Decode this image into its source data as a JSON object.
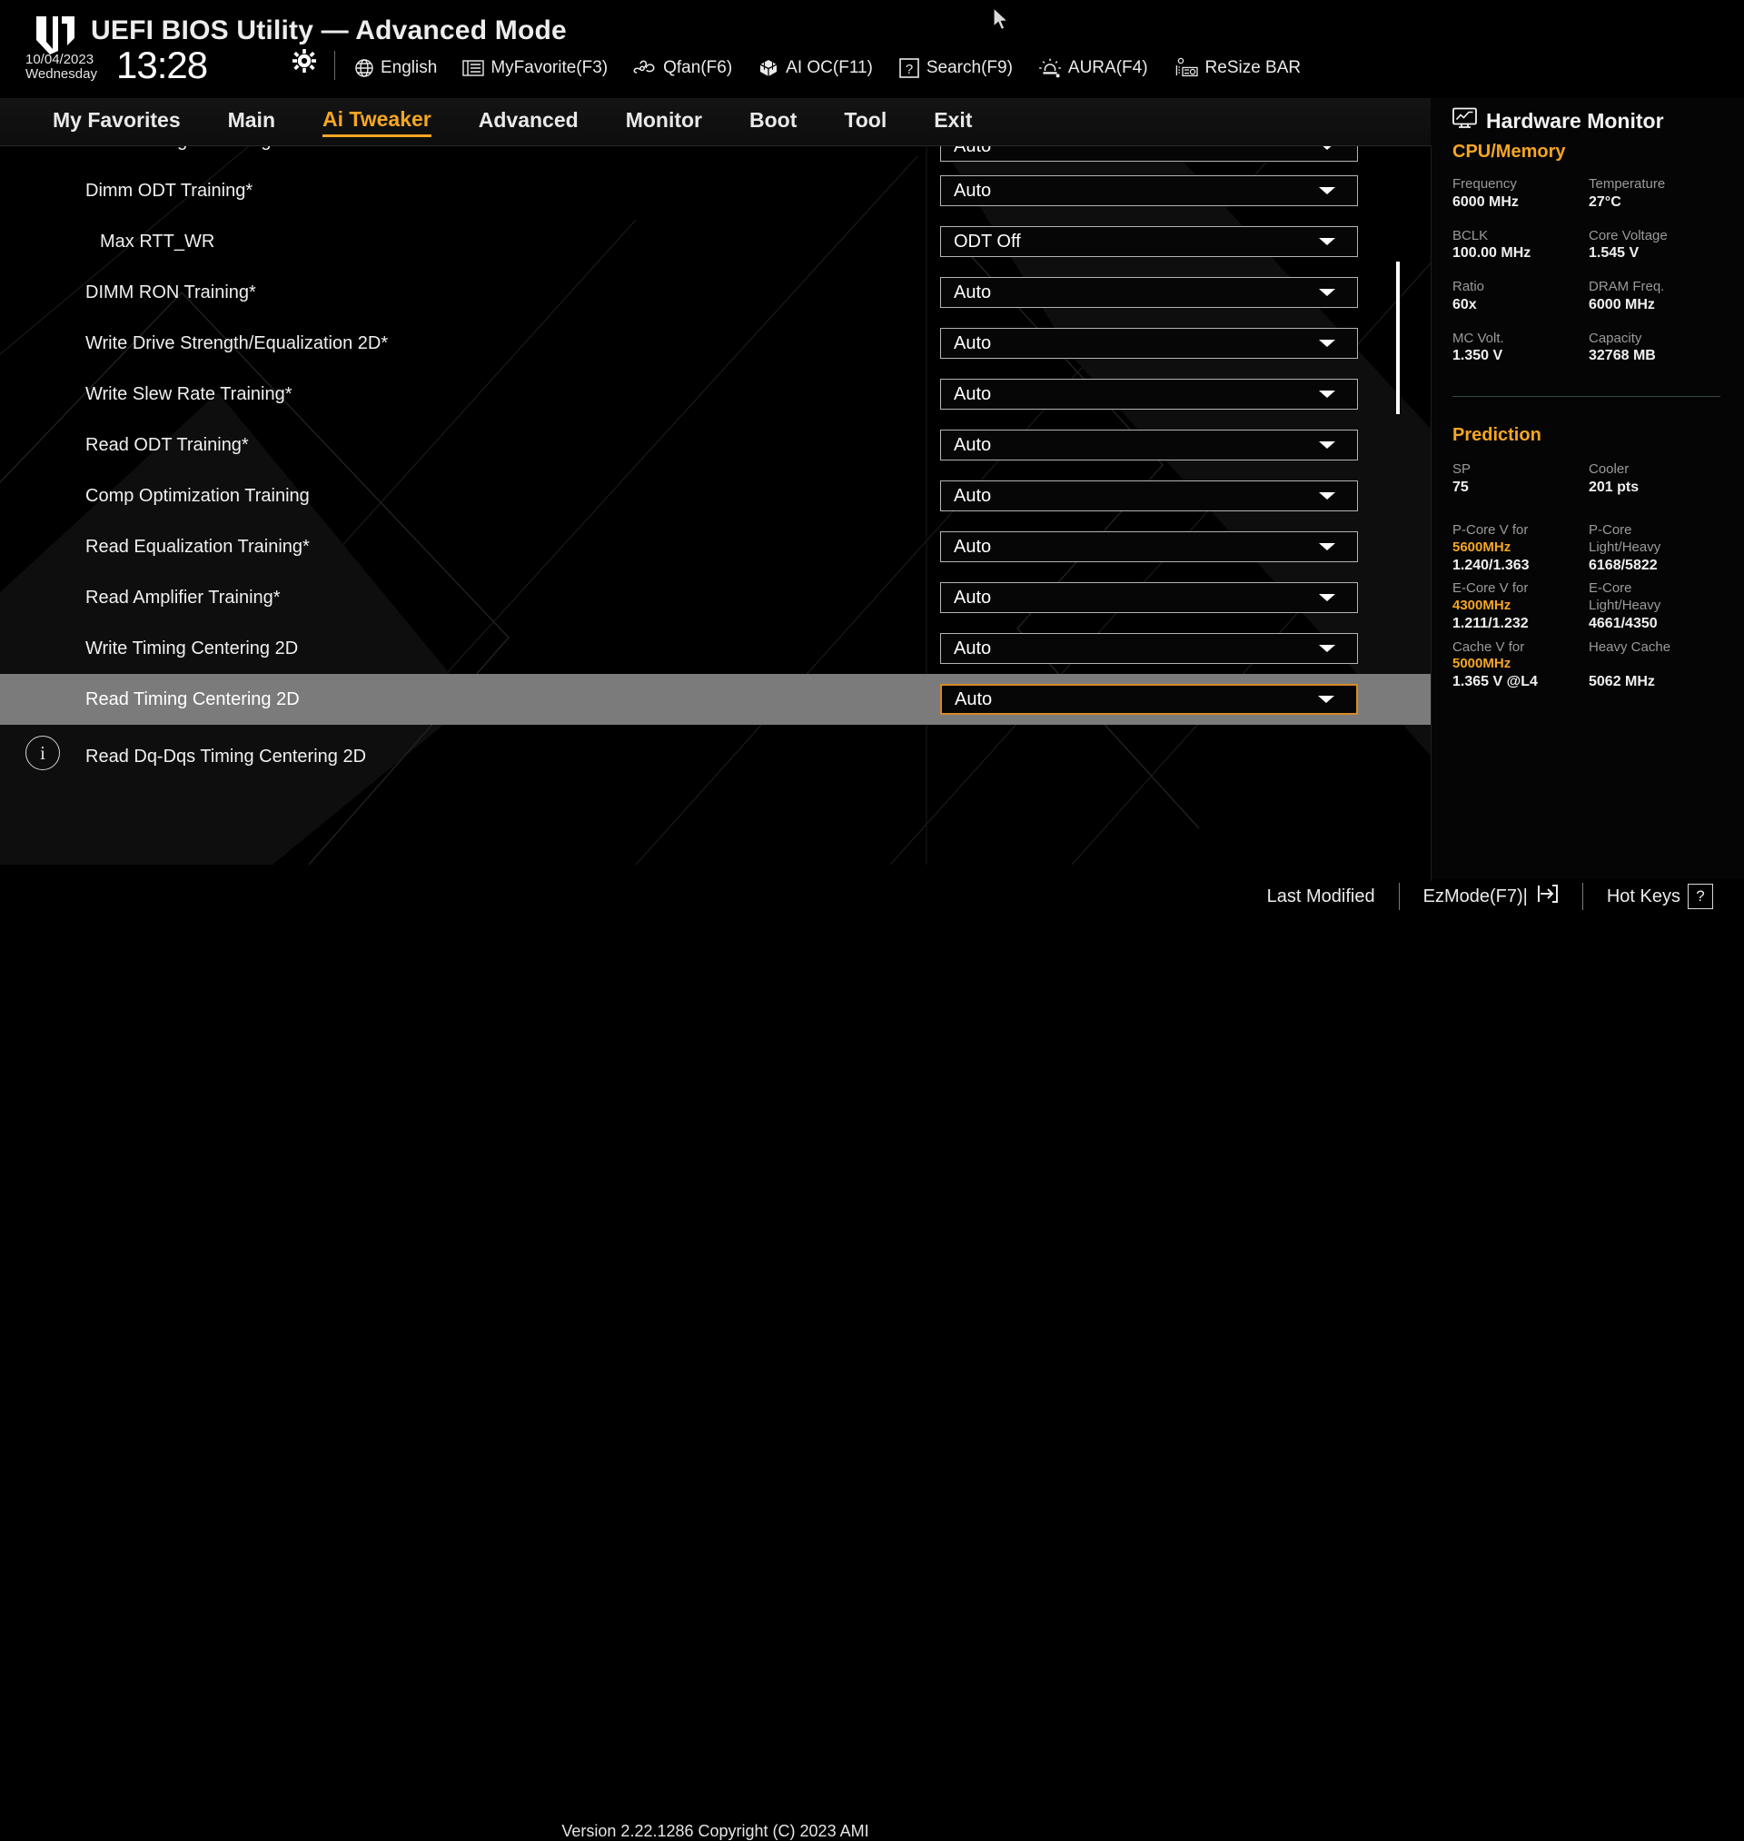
{
  "header": {
    "title": "UEFI BIOS Utility — Advanced Mode",
    "logo_icon": "tuf-gaming-logo",
    "date": "10/04/2023",
    "weekday": "Wednesday",
    "time": "13:28",
    "gear_icon": "gear-icon",
    "tools": [
      {
        "label": "English",
        "icon": "globe-icon"
      },
      {
        "label": "MyFavorite(F3)",
        "icon": "favorites-list-icon"
      },
      {
        "label": "Qfan(F6)",
        "icon": "fan-icon"
      },
      {
        "label": "AI OC(F11)",
        "icon": "ai-chip-icon"
      },
      {
        "label": "Search(F9)",
        "icon": "question-box-icon"
      },
      {
        "label": "AURA(F4)",
        "icon": "lighting-icon"
      },
      {
        "label": "ReSize BAR",
        "icon": "resize-bar-icon"
      }
    ]
  },
  "nav": {
    "items": [
      {
        "label": "My Favorites",
        "active": false
      },
      {
        "label": "Main",
        "active": false
      },
      {
        "label": "Ai Tweaker",
        "active": true
      },
      {
        "label": "Advanced",
        "active": false
      },
      {
        "label": "Monitor",
        "active": false
      },
      {
        "label": "Boot",
        "active": false
      },
      {
        "label": "Tool",
        "active": false
      },
      {
        "label": "Exit",
        "active": false
      }
    ],
    "active_color": "#f5a623"
  },
  "settings": [
    {
      "label": "Read Timing Centering with JR",
      "value": "Auto",
      "indent": false,
      "selected": false,
      "clipped": true
    },
    {
      "label": "Dimm ODT Training*",
      "value": "Auto",
      "indent": false,
      "selected": false,
      "clipped": false
    },
    {
      "label": "Max RTT_WR",
      "value": "ODT Off",
      "indent": true,
      "selected": false,
      "clipped": false
    },
    {
      "label": "DIMM RON Training*",
      "value": "Auto",
      "indent": false,
      "selected": false,
      "clipped": false
    },
    {
      "label": "Write Drive Strength/Equalization 2D*",
      "value": "Auto",
      "indent": false,
      "selected": false,
      "clipped": false
    },
    {
      "label": "Write Slew Rate Training*",
      "value": "Auto",
      "indent": false,
      "selected": false,
      "clipped": false
    },
    {
      "label": "Read ODT Training*",
      "value": "Auto",
      "indent": false,
      "selected": false,
      "clipped": false
    },
    {
      "label": "Comp Optimization Training",
      "value": "Auto",
      "indent": false,
      "selected": false,
      "clipped": false
    },
    {
      "label": "Read Equalization Training*",
      "value": "Auto",
      "indent": false,
      "selected": false,
      "clipped": false
    },
    {
      "label": "Read Amplifier Training*",
      "value": "Auto",
      "indent": false,
      "selected": false,
      "clipped": false
    },
    {
      "label": "Write Timing Centering 2D",
      "value": "Auto",
      "indent": false,
      "selected": false,
      "clipped": false
    },
    {
      "label": "Read Timing Centering 2D",
      "value": "Auto",
      "indent": false,
      "selected": true,
      "clipped": false
    }
  ],
  "info": {
    "icon": "info-icon",
    "label": "Read Dq-Dqs Timing Centering 2D"
  },
  "hardware_monitor": {
    "title": "Hardware Monitor",
    "icon": "monitor-graph-icon",
    "cpu_memory": {
      "section": "CPU/Memory",
      "items": [
        {
          "key": "Frequency",
          "value": "6000 MHz"
        },
        {
          "key": "Temperature",
          "value": "27°C"
        },
        {
          "key": "BCLK",
          "value": "100.00 MHz"
        },
        {
          "key": "Core Voltage",
          "value": "1.545 V"
        },
        {
          "key": "Ratio",
          "value": "60x"
        },
        {
          "key": "DRAM Freq.",
          "value": "6000 MHz"
        },
        {
          "key": "MC Volt.",
          "value": "1.350 V"
        },
        {
          "key": "Capacity",
          "value": "32768 MB"
        }
      ]
    },
    "prediction": {
      "section": "Prediction",
      "items": [
        {
          "key": "SP",
          "value": "75"
        },
        {
          "key": "Cooler",
          "value": "201 pts"
        }
      ],
      "cores": [
        {
          "key_line1": "P-Core V for",
          "key_line2": "5600MHz",
          "value": "1.240/1.363",
          "key2_line1": "P-Core",
          "key2_line2": "Light/Heavy",
          "value2": "6168/5822"
        },
        {
          "key_line1": "E-Core V for",
          "key_line2": "4300MHz",
          "value": "1.211/1.232",
          "key2_line1": "E-Core",
          "key2_line2": "Light/Heavy",
          "value2": "4661/4350"
        },
        {
          "key_line1": "Cache V for",
          "key_line2": "5000MHz",
          "value": "1.365 V @L4",
          "key2_line1": "Heavy Cache",
          "key2_line2": "",
          "value2": "5062 MHz"
        }
      ]
    }
  },
  "footer": {
    "last_modified": "Last Modified",
    "ez_mode": "EzMode(F7)|",
    "ez_mode_icon": "exit-arrow-icon",
    "hot_keys": "Hot Keys",
    "hot_keys_icon": "question-box-icon",
    "version": "Version 2.22.1286 Copyright (C) 2023 AMI"
  },
  "cursor": {
    "icon": "mouse-pointer-icon"
  }
}
